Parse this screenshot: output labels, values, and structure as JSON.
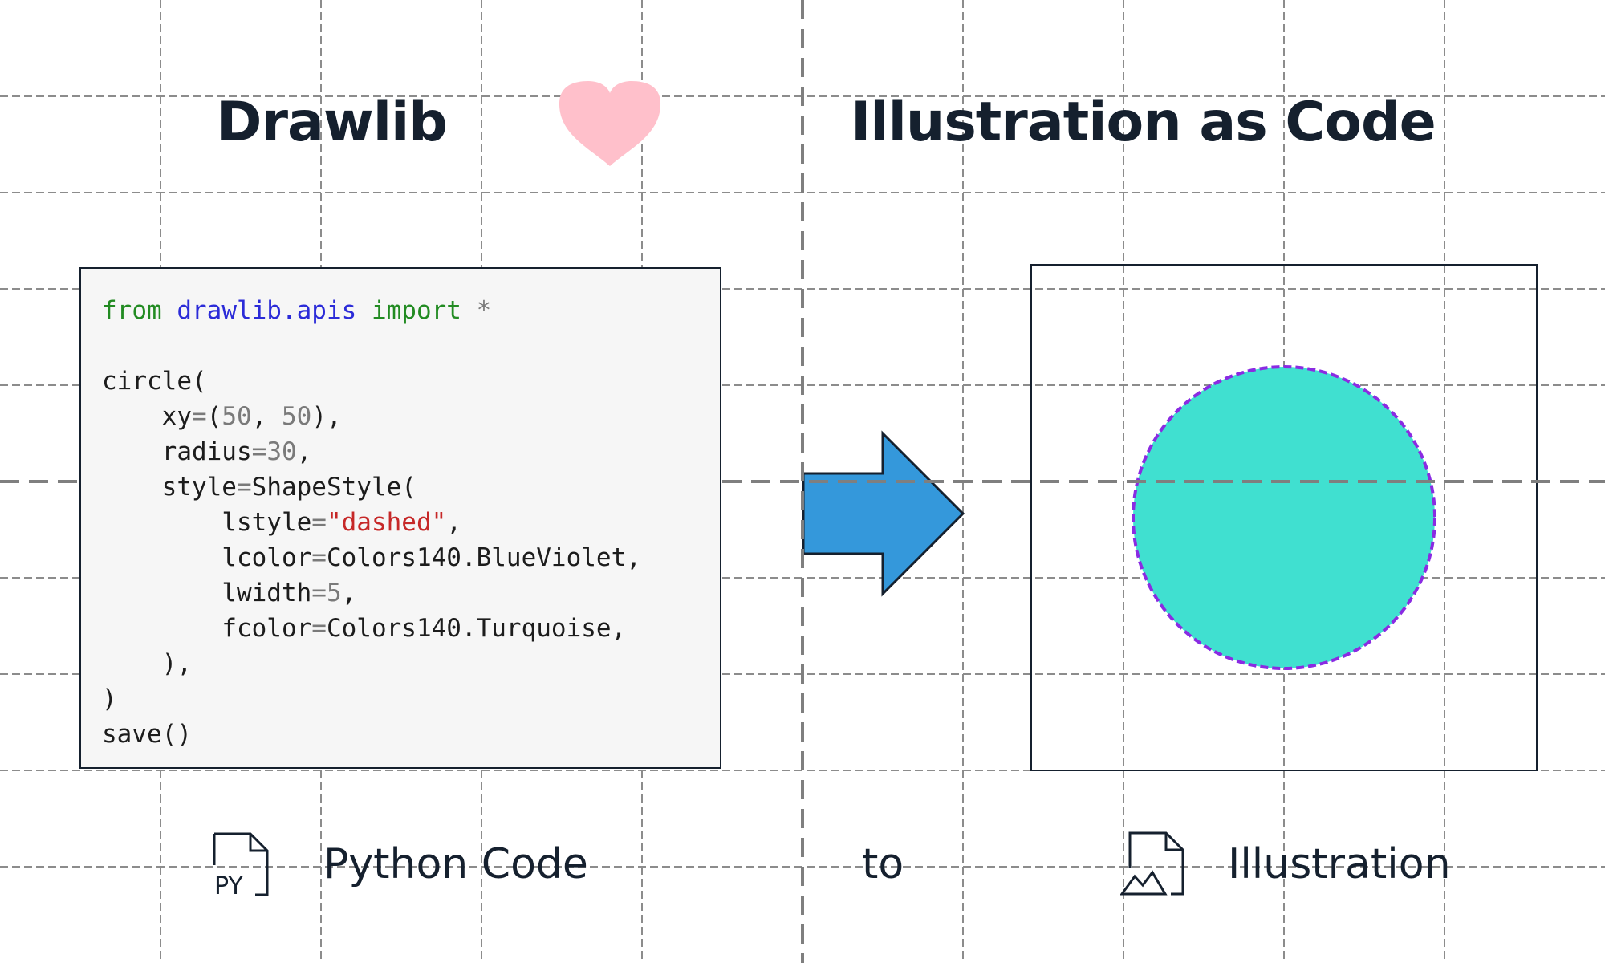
{
  "header": {
    "left_title": "Drawlib",
    "right_title": "Illustration as Code"
  },
  "code": {
    "import_from": "from",
    "import_module": "drawlib.apis",
    "import_keyword": "import",
    "import_star": "*",
    "fn_circle": "circle(",
    "xy_name": "xy",
    "xy_open": "(",
    "xy_x": "50",
    "xy_sep": ", ",
    "xy_y": "50",
    "xy_close": "),",
    "radius_name": "radius",
    "radius_value": "30",
    "style_name": "style",
    "style_call": "ShapeStyle(",
    "lstyle_name": "lstyle",
    "lstyle_value": "\"dashed\"",
    "lcolor_name": "lcolor",
    "lcolor_value": "Colors140.BlueViolet,",
    "lwidth_name": "lwidth",
    "lwidth_value": "5",
    "fcolor_name": "fcolor",
    "fcolor_value": "Colors140.Turquoise,",
    "style_close": "),",
    "circle_close": ")",
    "save_call": "save()"
  },
  "captions": {
    "code_label": "Python Code",
    "to_label": "to",
    "illustration_label": "Illustration"
  },
  "icons": {
    "heart": "heart-icon",
    "python_file": "python-file-icon",
    "python_file_text": "PY",
    "image_file": "image-file-icon",
    "arrow": "arrow-right-icon"
  },
  "colors": {
    "title": "#15202e",
    "heart": "#ffc0cb",
    "arrow_fill": "#3498db",
    "circle_fill": "#40e0d0",
    "circle_stroke": "#8a2be2",
    "keyword": "#228b22",
    "module": "#2b2bd8",
    "string": "#c62828"
  }
}
